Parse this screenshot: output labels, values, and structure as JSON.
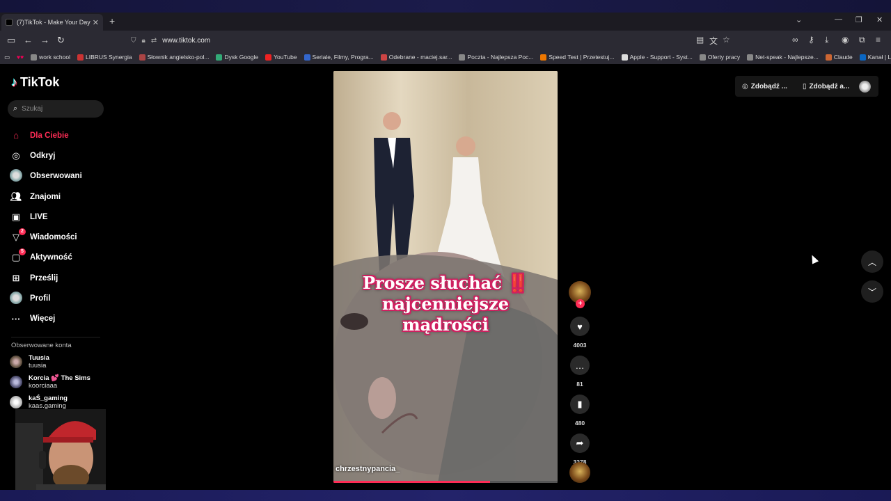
{
  "browser": {
    "tab_title": "(7)TikTok - Make Your Day",
    "url": "www.tiktok.com",
    "bookmarks": [
      "work school",
      "LIBRUS Synergia",
      "Słownik angielsko-pol...",
      "Dysk Google",
      "YouTube",
      "Seriale, Filmy, Progra...",
      "Odebrane - maciej.sar...",
      "Poczta - Najlepsza Poc...",
      "Speed Test | Przetestuj...",
      "Apple - Support - Syst...",
      "Oferty pracy",
      "Net-speak - Najlepsze...",
      "Claude",
      "Kanał | LinkedIn"
    ]
  },
  "sidebar": {
    "logo": "TikTok",
    "search_placeholder": "Szukaj",
    "nav": [
      {
        "label": "Dla Ciebie",
        "icon": "home-icon"
      },
      {
        "label": "Odkryj",
        "icon": "compass-icon"
      },
      {
        "label": "Obserwowani",
        "icon": "following-avatar-icon"
      },
      {
        "label": "Znajomi",
        "icon": "friends-icon"
      },
      {
        "label": "LIVE",
        "icon": "live-icon"
      },
      {
        "label": "Wiadomości",
        "icon": "messages-icon",
        "badge": "2"
      },
      {
        "label": "Aktywność",
        "icon": "activity-icon",
        "badge": "5"
      },
      {
        "label": "Prześlij",
        "icon": "upload-icon"
      },
      {
        "label": "Profil",
        "icon": "profile-icon"
      },
      {
        "label": "Więcej",
        "icon": "more-icon"
      }
    ],
    "following_title": "Obserwowane konta",
    "following": [
      {
        "name": "Tuusia",
        "username": "tuusia"
      },
      {
        "name": "Korcia 💕 The Sims",
        "username": "koorciaaa"
      },
      {
        "name": "kaŚ_gaming",
        "username": "kaas.gaming"
      }
    ]
  },
  "video": {
    "caption_line1": "Prosze słuchać ‼️",
    "caption_line2": "najcenniejsze",
    "caption_line3": "mądrości",
    "author": "chrzestnypancia_",
    "progress": 0.7
  },
  "actions": {
    "likes": "4003",
    "comments": "81",
    "saves": "480",
    "shares": "3278"
  },
  "topright": {
    "get_coins": "Zdobądź ...",
    "get_app": "Zdobądź a..."
  },
  "colors": {
    "accent": "#fe2c55",
    "background": "#000000"
  }
}
